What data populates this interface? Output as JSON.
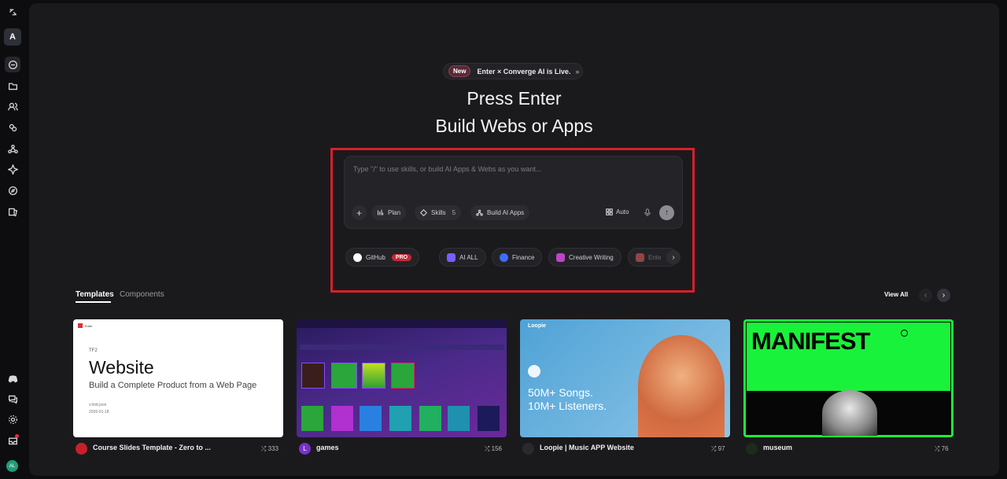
{
  "sidebar": {
    "avatar_letter": "A",
    "user_initials": "AL"
  },
  "announcement": {
    "badge": "New",
    "text": "Enter × Converge AI is Live.",
    "arrow": "»"
  },
  "hero": {
    "line1": "Press Enter",
    "line2": "Build Webs or Apps"
  },
  "prompt": {
    "placeholder": "Type \"/\" to use skills, or build AI Apps & Webs as you want...",
    "plus": "+",
    "plan": "Plan",
    "skills": "Skills",
    "skills_count": "5",
    "build_ai_apps": "Build AI Apps",
    "auto": "Auto",
    "send": "↑"
  },
  "chips": [
    {
      "label": "GitHub",
      "badge": "PRO",
      "color": "#3a3a40"
    },
    {
      "label": "AI ALL",
      "color": "#7b5cff"
    },
    {
      "label": "Finance",
      "color": "#3d6cff"
    },
    {
      "label": "Creative Writing",
      "color": "#c044c8"
    },
    {
      "label": "Ente",
      "color": "#e05a5a"
    }
  ],
  "chips_next": "›",
  "tabs": {
    "templates": "Templates",
    "components": "Components"
  },
  "view_all": "View All",
  "nav": {
    "prev": "‹",
    "next": "›"
  },
  "templates": [
    {
      "title": "Course Slides Template - Zero to ...",
      "count": "333",
      "card": {
        "brand": "Enter",
        "tag": "TF2",
        "heading": "Website",
        "sub": "Build a Complete Product from a Web Page",
        "meta1": "v.htdr.json",
        "meta2": "2026-01-18"
      }
    },
    {
      "title": "games",
      "count": "156",
      "avatar_letter": "L"
    },
    {
      "title": "Loopie | Music APP Website",
      "count": "97",
      "card": {
        "brand": "Loopie",
        "line1": "50M+ Songs.",
        "line2": "10M+ Listeners."
      }
    },
    {
      "title": "museum",
      "count": "76",
      "card": {
        "heading": "MANIFEST"
      }
    }
  ],
  "colors": {
    "accent_red": "#d6202c",
    "museum_green": "#19f23a",
    "background": "#1a1a1d"
  }
}
